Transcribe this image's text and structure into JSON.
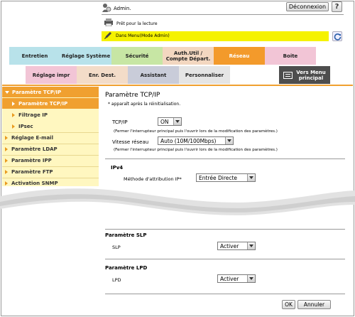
{
  "header": {
    "user": "Admin.",
    "logout_label": "Déconnexion",
    "help_label": "?",
    "status_ready": "Prêt pour la lecture",
    "status_mode": "Dans Menu(Mode Admin)"
  },
  "tabs_row1": [
    "Entretien",
    "Réglage Système",
    "Sécurité",
    "Auth.Util / Compte Départ.",
    "Réseau",
    "Boite"
  ],
  "tabs_row2": [
    "Réglage impr",
    "Enr. Dest.",
    "Assistant",
    "Personnaliser"
  ],
  "main_menu_label": "Vers Menu principal",
  "sidebar": {
    "items": [
      {
        "label": "Paramètre TCP/IP"
      },
      {
        "label": "Paramètre TCP/IP"
      },
      {
        "label": "Filtrage IP"
      },
      {
        "label": "IPsec"
      },
      {
        "label": "Réglage E-mail"
      },
      {
        "label": "Paramètre LDAP"
      },
      {
        "label": "Paramètre IPP"
      },
      {
        "label": "Paramètre FTP"
      },
      {
        "label": "Activation SNMP"
      }
    ]
  },
  "main": {
    "title": "Paramètre TCP/IP",
    "note": "* apparaît après la réinitialisation.",
    "tcpip_label": "TCP/IP",
    "tcpip_value": "ON",
    "tcpip_hint": "(Fermer l'interrupteur principal puis l'ouvrir lors de la modification des paramètres.)",
    "speed_label": "Vitesse réseau",
    "speed_value": "Auto (10M/100Mbps)",
    "speed_hint": "(Fermer l'interrupteur principal puis l'ouvrir lors de la modification des paramètres.)",
    "ipv4_label": "IPv4",
    "method_label": "Méthode d'attribution IP*",
    "method_value": "Entrée Directe",
    "slp_title": "Paramètre SLP",
    "slp_label": "SLP",
    "slp_value": "Activer",
    "lpd_title": "Paramètre LPD",
    "lpd_label": "LPD",
    "lpd_value": "Activer",
    "ok_label": "OK",
    "cancel_label": "Annuler"
  },
  "colors": {
    "tab_entretien": "#b8e2ea",
    "tab_reglage": "#b8e2ea",
    "tab_securite": "#c7e6a4",
    "tab_auth": "#f3d7c0",
    "tab_reseau": "#f39a2b",
    "tab_boite": "#f2c5d6",
    "sidebar_active": "#f0a030",
    "sidebar_bg": "#fff7c0",
    "status_mode": "#f5f200"
  }
}
